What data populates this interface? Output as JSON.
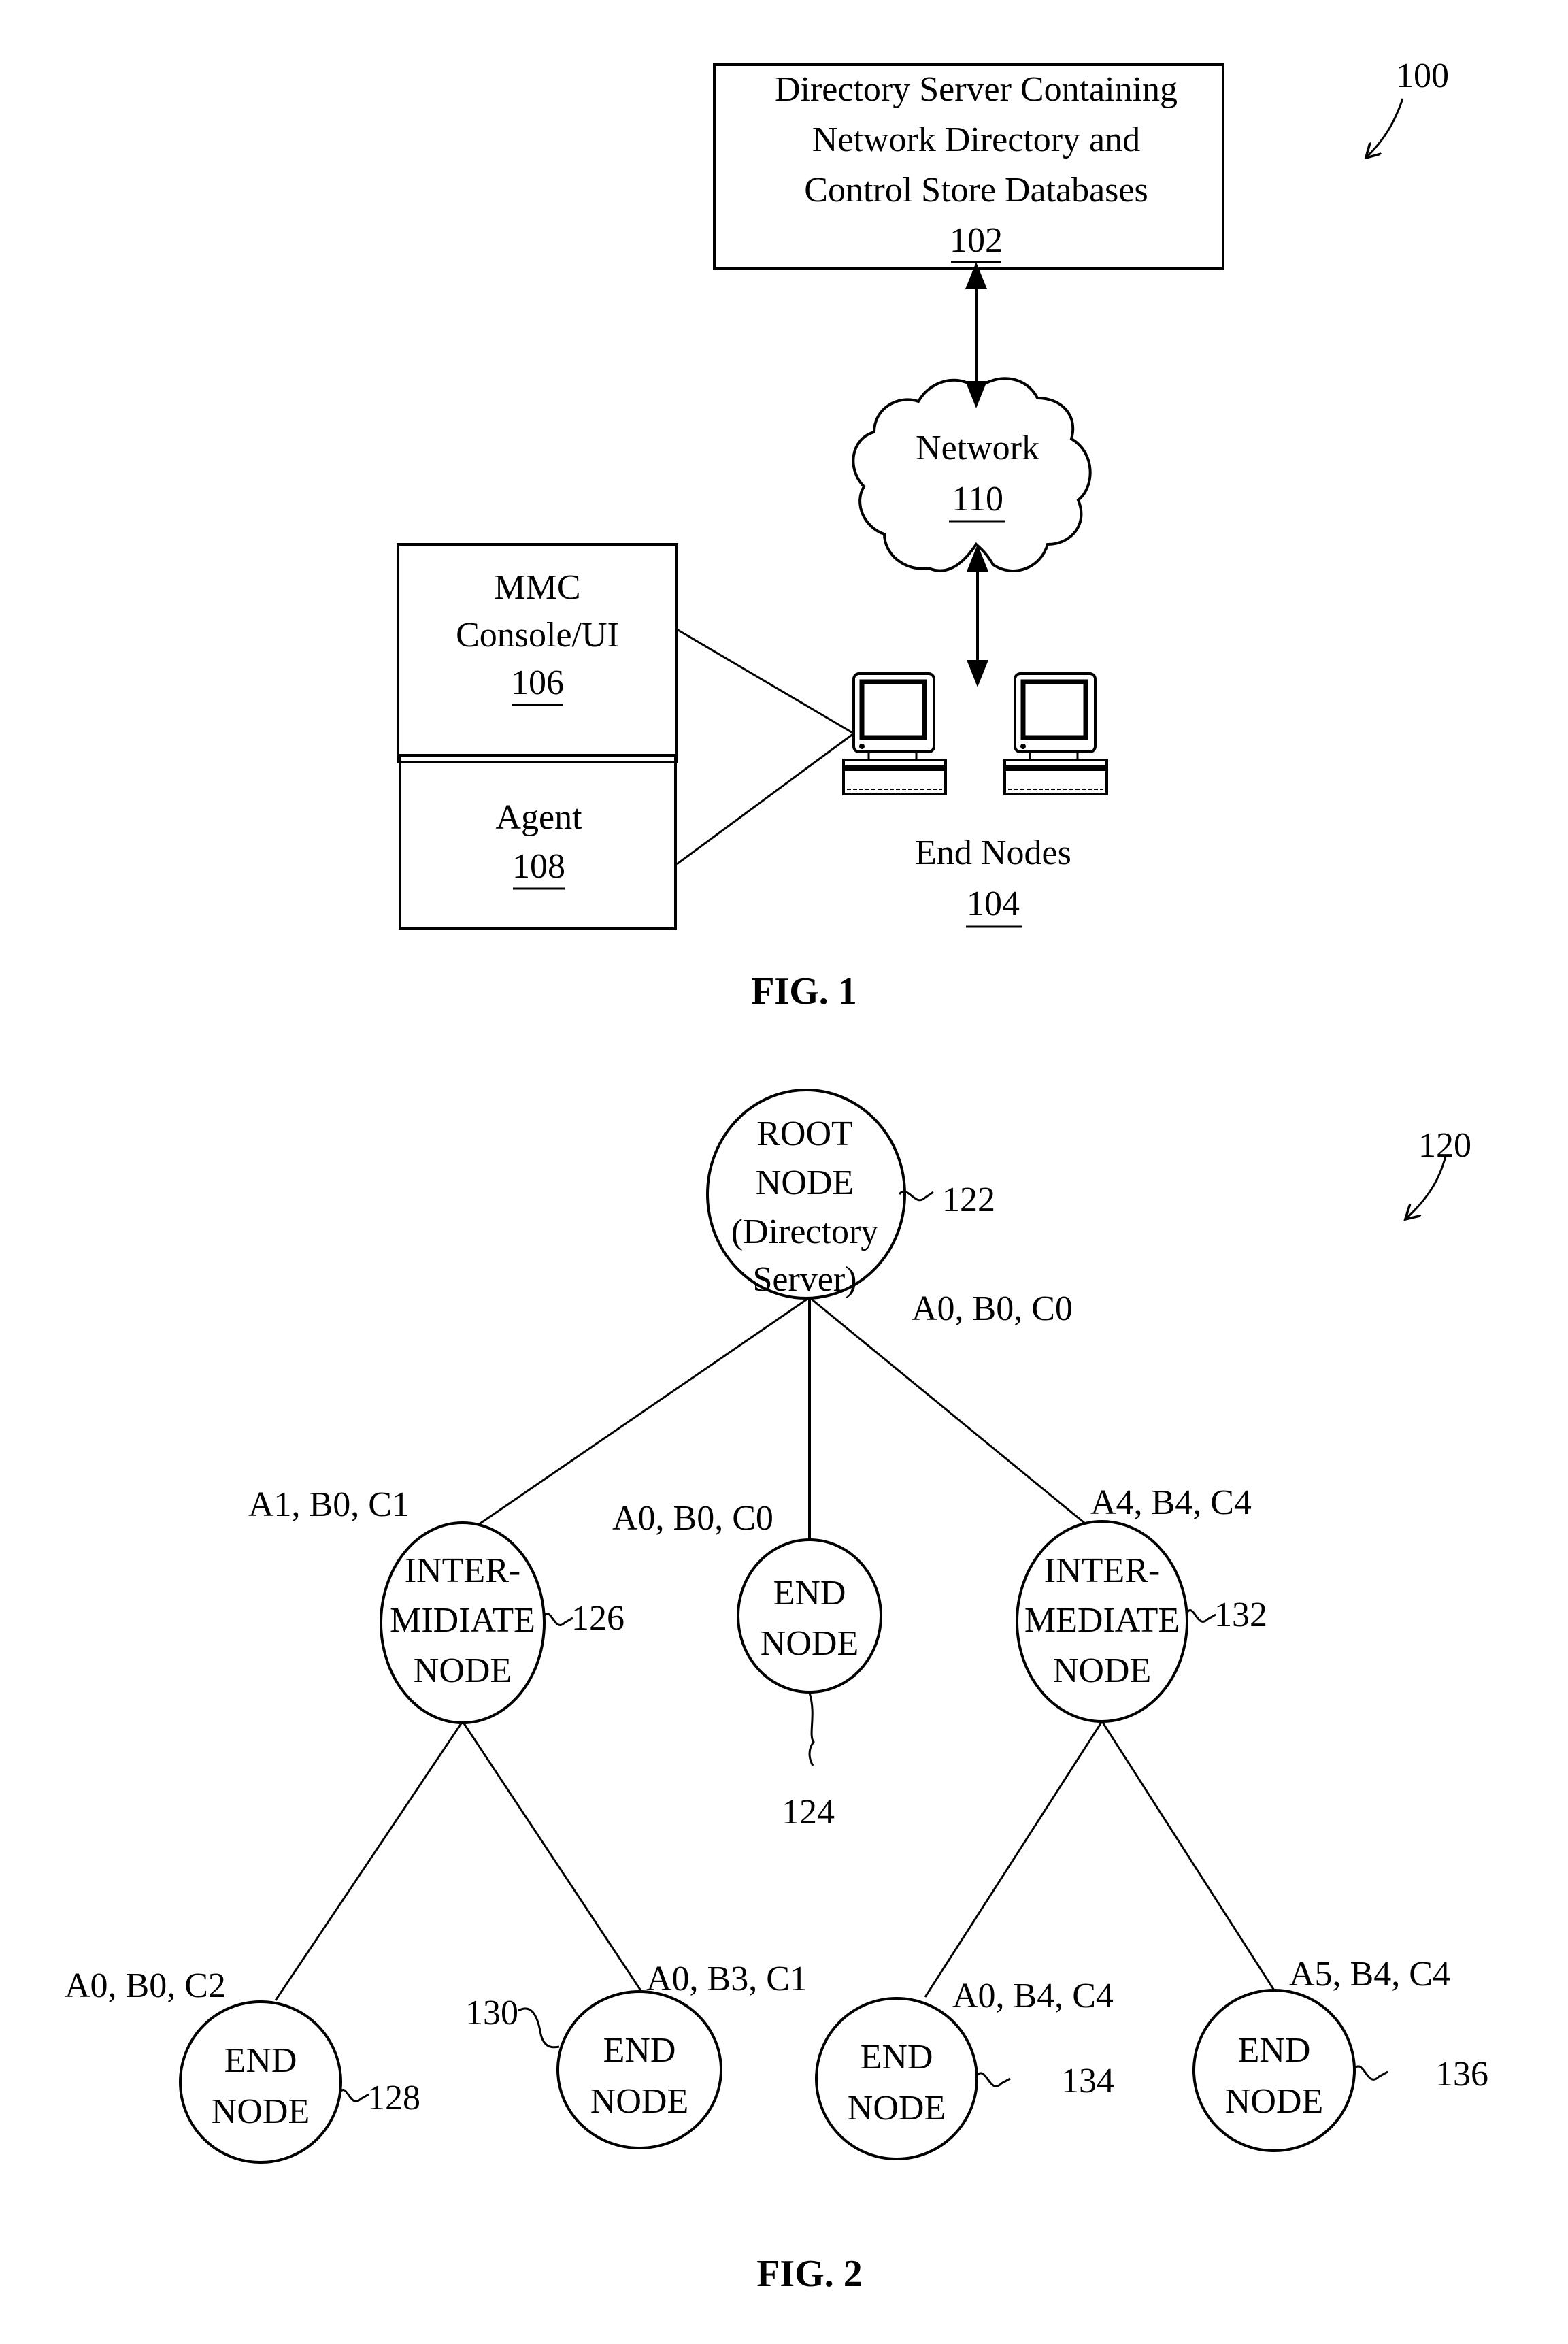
{
  "fig1": {
    "ref": "100",
    "caption": "FIG. 1",
    "directory_server": {
      "lines": [
        "Directory Server Containing",
        "Network Directory and",
        "Control Store Databases"
      ],
      "ref": "102"
    },
    "network": {
      "label": "Network",
      "ref": "110"
    },
    "mmc": {
      "lines": [
        "MMC",
        "Console/UI"
      ],
      "ref": "106"
    },
    "agent": {
      "label": "Agent",
      "ref": "108"
    },
    "end_nodes": {
      "label": "End Nodes",
      "ref": "104"
    }
  },
  "fig2": {
    "ref": "120",
    "caption": "FIG. 2",
    "nodes": [
      {
        "id": "root",
        "lines": [
          "ROOT",
          "NODE",
          "(Directory",
          "Server)"
        ],
        "ref": "122",
        "attrs": "A0, B0, C0"
      },
      {
        "id": "intermediate-left",
        "lines": [
          "INTER-",
          "MIDIATE",
          "NODE"
        ],
        "ref": "126",
        "attrs": "A1, B0, C1"
      },
      {
        "id": "end-center",
        "lines": [
          "END",
          "NODE"
        ],
        "ref": "124",
        "attrs": "A0, B0, C0"
      },
      {
        "id": "intermediate-right",
        "lines": [
          "INTER-",
          "MEDIATE",
          "NODE"
        ],
        "ref": "132",
        "attrs": "A4, B4, C4"
      },
      {
        "id": "end-128",
        "lines": [
          "END",
          "NODE"
        ],
        "ref": "128",
        "attrs": "A0, B0, C2"
      },
      {
        "id": "end-130",
        "lines": [
          "END",
          "NODE"
        ],
        "ref": "130",
        "attrs": "A0, B3, C1"
      },
      {
        "id": "end-134",
        "lines": [
          "END",
          "NODE"
        ],
        "ref": "134",
        "attrs": "A0, B4, C4"
      },
      {
        "id": "end-136",
        "lines": [
          "END",
          "NODE"
        ],
        "ref": "136",
        "attrs": "A5, B4, C4"
      }
    ]
  }
}
